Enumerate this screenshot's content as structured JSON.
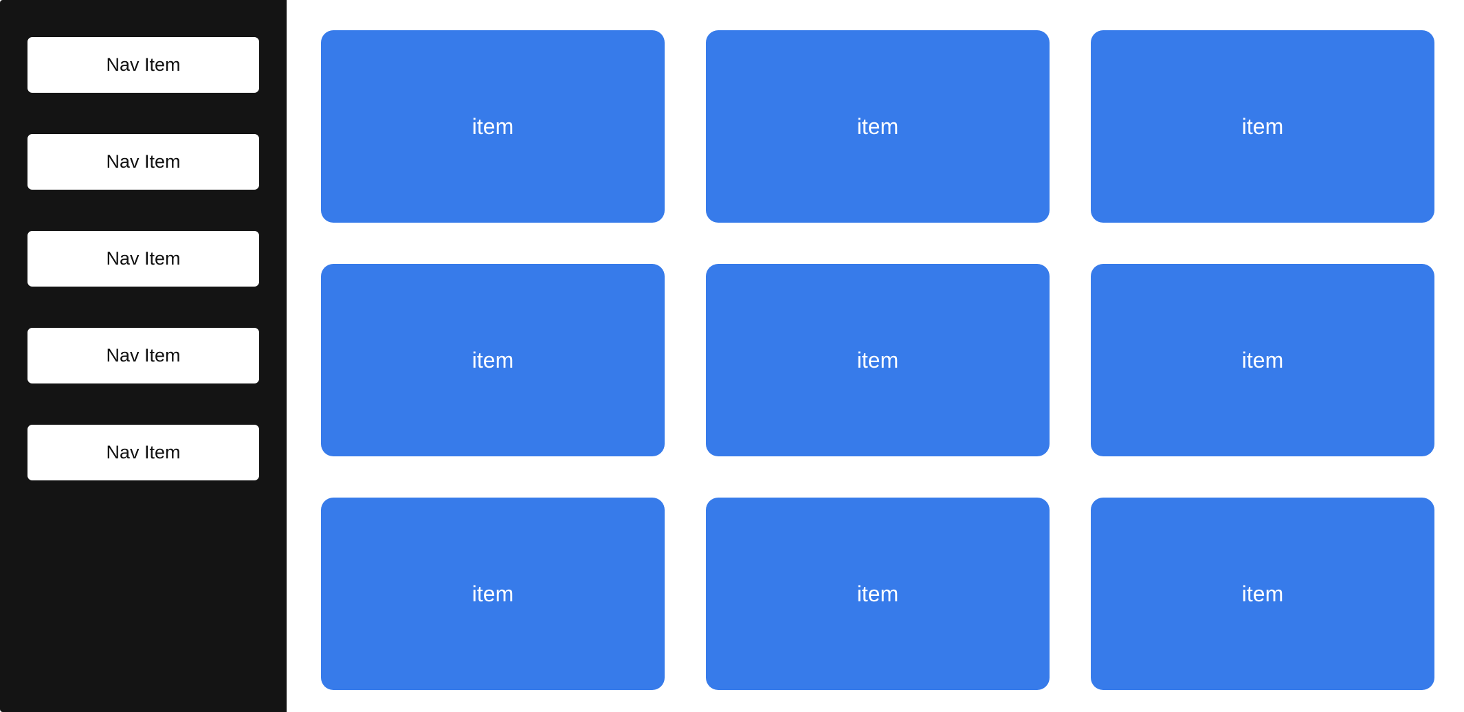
{
  "theme": {
    "sidebar_background": "#141414",
    "nav_item_background": "#ffffff",
    "nav_item_text": "#111111",
    "card_background": "#377bea",
    "card_text": "#ffffff",
    "page_background": "#ffffff"
  },
  "sidebar": {
    "items": [
      {
        "label": "Nav Item"
      },
      {
        "label": "Nav Item"
      },
      {
        "label": "Nav Item"
      },
      {
        "label": "Nav Item"
      },
      {
        "label": "Nav Item"
      }
    ]
  },
  "grid": {
    "items": [
      {
        "label": "item"
      },
      {
        "label": "item"
      },
      {
        "label": "item"
      },
      {
        "label": "item"
      },
      {
        "label": "item"
      },
      {
        "label": "item"
      },
      {
        "label": "item"
      },
      {
        "label": "item"
      },
      {
        "label": "item"
      }
    ]
  }
}
